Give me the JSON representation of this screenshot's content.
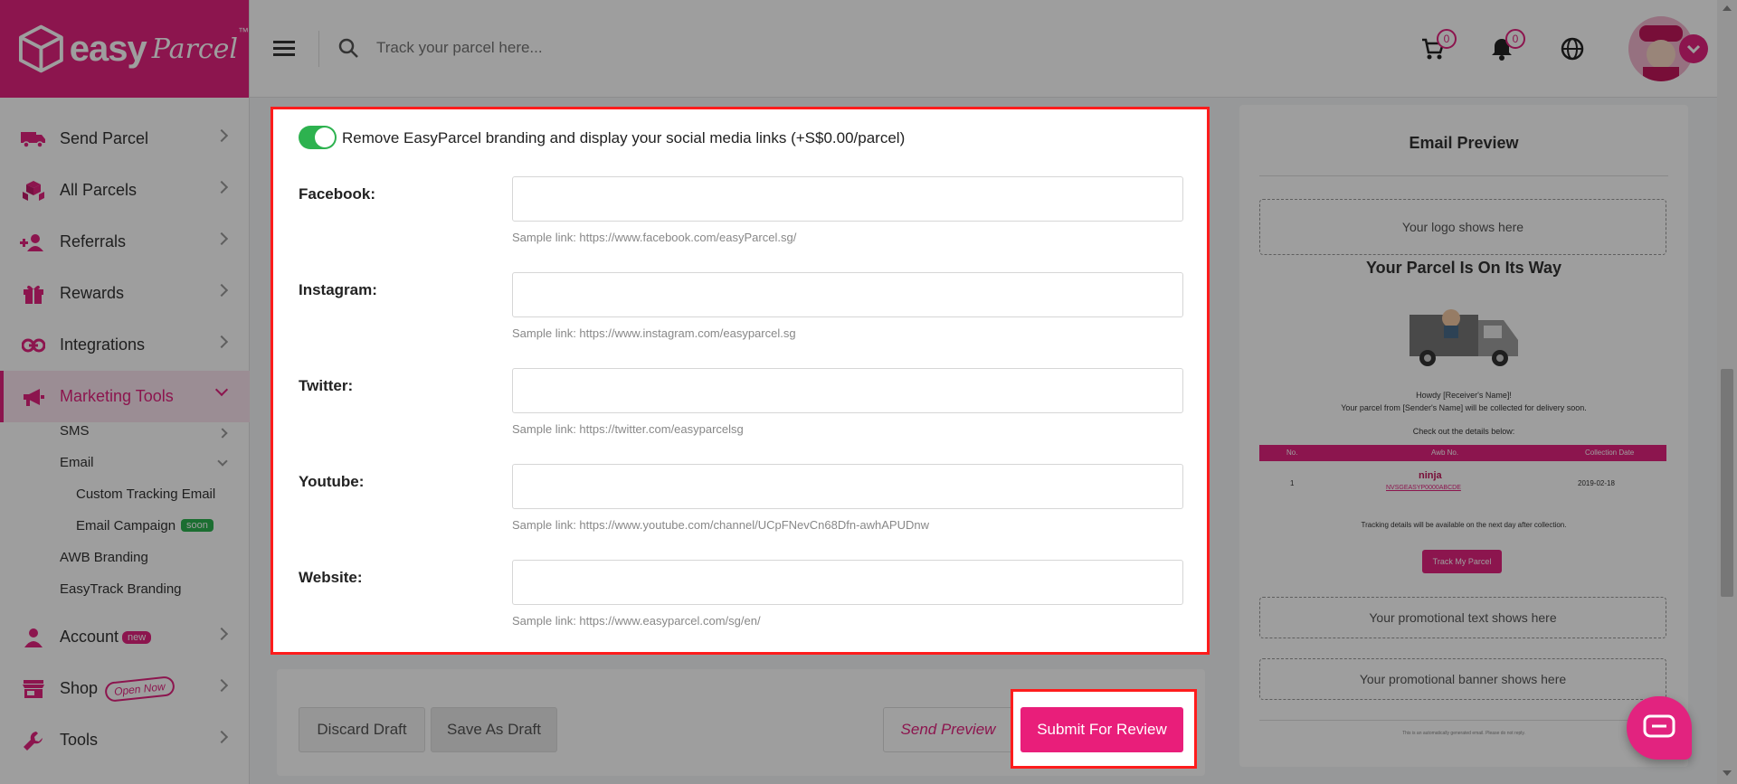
{
  "brand": {
    "name": "easy",
    "name2": "Parcel",
    "tm": "™",
    "color": "#e2237f"
  },
  "header": {
    "search_placeholder": "Track your parcel here...",
    "cart_count": "0",
    "notification_count": "0"
  },
  "sidebar": {
    "items": [
      {
        "label": "Send Parcel",
        "icon": "truck-icon"
      },
      {
        "label": "All Parcels",
        "icon": "boxes-icon"
      },
      {
        "label": "Referrals",
        "icon": "users-plus-icon"
      },
      {
        "label": "Rewards",
        "icon": "gift-icon"
      },
      {
        "label": "Integrations",
        "icon": "link-icon"
      },
      {
        "label": "Marketing Tools",
        "icon": "megaphone-icon"
      },
      {
        "label": "Account",
        "icon": "user-icon",
        "badge": "new"
      },
      {
        "label": "Shop",
        "icon": "store-icon",
        "badge": "Open Now"
      },
      {
        "label": "Tools",
        "icon": "wrench-icon"
      }
    ],
    "sub": {
      "sms": "SMS",
      "email": "Email",
      "custom_tracking": "Custom Tracking Email",
      "campaign": "Email Campaign",
      "campaign_badge": "soon",
      "awb": "AWB Branding",
      "easytrack": "EasyTrack Branding"
    }
  },
  "form": {
    "toggle_label": "Remove EasyParcel branding and display your social media links (+S$0.00/parcel)",
    "toggle_on": true,
    "fields": [
      {
        "label": "Facebook:",
        "value": "",
        "hint": "Sample link: https://www.facebook.com/easyParcel.sg/"
      },
      {
        "label": "Instagram:",
        "value": "",
        "hint": "Sample link: https://www.instagram.com/easyparcel.sg"
      },
      {
        "label": "Twitter:",
        "value": "",
        "hint": "Sample link: https://twitter.com/easyparcelsg"
      },
      {
        "label": "Youtube:",
        "value": "",
        "hint": "Sample link: https://www.youtube.com/channel/UCpFNevCn68Dfn-awhAPUDnw"
      },
      {
        "label": "Website:",
        "value": "",
        "hint": "Sample link: https://www.easyparcel.com/sg/en/"
      }
    ]
  },
  "actions": {
    "discard": "Discard Draft",
    "save": "Save As Draft",
    "preview": "Send Preview",
    "submit": "Submit For Review"
  },
  "preview": {
    "title": "Email Preview",
    "logo_placeholder": "Your logo shows here",
    "heading": "Your Parcel Is On Its Way",
    "greeting": "Howdy [Receiver's Name]!",
    "body": "Your parcel from [Sender's Name] will be collected for delivery soon.",
    "details": "Check out the details below:",
    "table_headers": {
      "no": "No.",
      "awb": "Awb No.",
      "date": "Collection Date"
    },
    "table_row": {
      "no": "1",
      "courier": "ninja",
      "awb": "NVSGEASYP0000ABCDE",
      "date": "2019-02-18"
    },
    "tracking_note": "Tracking details will be available on the next day after collection.",
    "track_button": "Track My Parcel",
    "promo_text": "Your promotional text shows here",
    "promo_banner": "Your promotional banner shows here",
    "footer": "This is an automatically generated email. Please do not reply."
  }
}
